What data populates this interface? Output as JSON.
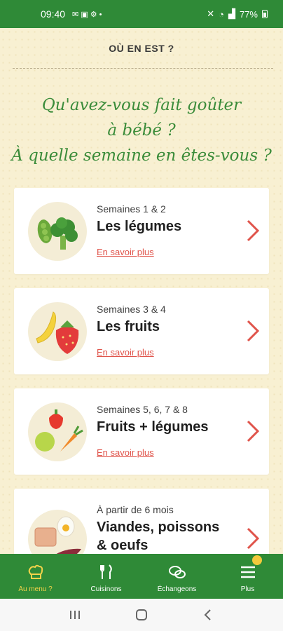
{
  "status": {
    "time": "09:40",
    "battery": "77%"
  },
  "header": {
    "title": "OÙ EN EST ?"
  },
  "headline": {
    "line1": "Qu'avez-vous fait goûter",
    "line2": "à bébé ?",
    "line3": "À quelle semaine en êtes-vous ?"
  },
  "cards": [
    {
      "weeks": "Semaines 1 & 2",
      "title": "Les légumes",
      "link": "En savoir plus"
    },
    {
      "weeks": "Semaines 3 & 4",
      "title": "Les fruits",
      "link": "En savoir plus"
    },
    {
      "weeks": "Semaines 5, 6, 7 & 8",
      "title": "Fruits + légumes",
      "link": "En savoir plus"
    },
    {
      "weeks": "À partir de 6 mois",
      "title_line1": "Viandes, poissons",
      "title_line2": "& oeufs"
    }
  ],
  "tabs": [
    {
      "label": "Au menu ?"
    },
    {
      "label": "Cuisinons"
    },
    {
      "label": "Échangeons"
    },
    {
      "label": "Plus"
    }
  ],
  "colors": {
    "brand_green": "#2f8a37",
    "accent_red": "#e0544b",
    "active_yellow": "#f3d34a"
  }
}
